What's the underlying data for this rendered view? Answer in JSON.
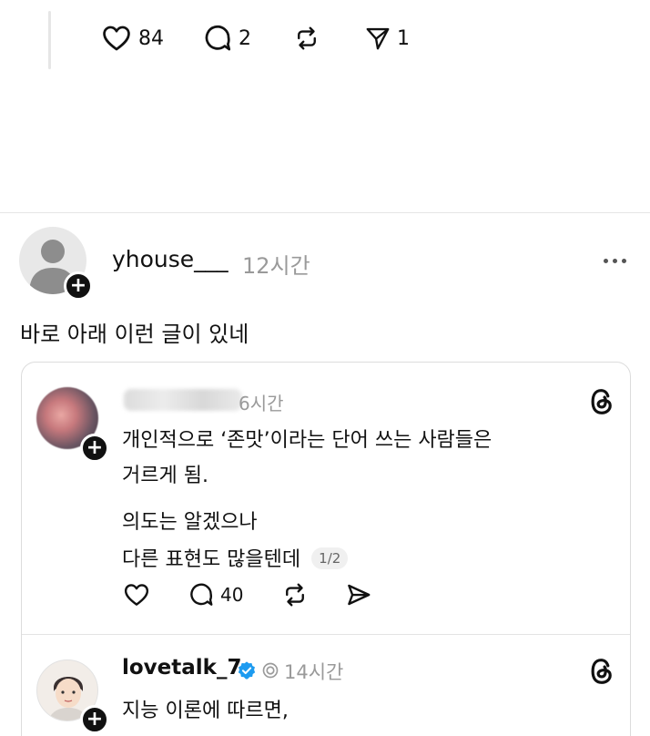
{
  "top_post": {
    "likes": "84",
    "replies": "2",
    "shares": "1"
  },
  "post": {
    "username": "yhouse___",
    "time": "12시간",
    "text": "바로 아래 이런 글이 있네"
  },
  "quoted_1": {
    "time": "6시간",
    "lines": [
      "개인적으로 ‘존맛’이라는 단어 쓰는 사람들은",
      "거르게 됨.",
      "의도는 알겠으나",
      "다른 표현도 많을텐데"
    ],
    "pager": "1/2",
    "replies": "40"
  },
  "quoted_2": {
    "username": "lovetalk_7",
    "time": "14시간",
    "text": "지능 이론에 따르면,"
  },
  "colors": {
    "text": "#111111",
    "muted": "#9a9a9a",
    "divider": "#e6e6e6",
    "verified": "#1d9bf0"
  }
}
